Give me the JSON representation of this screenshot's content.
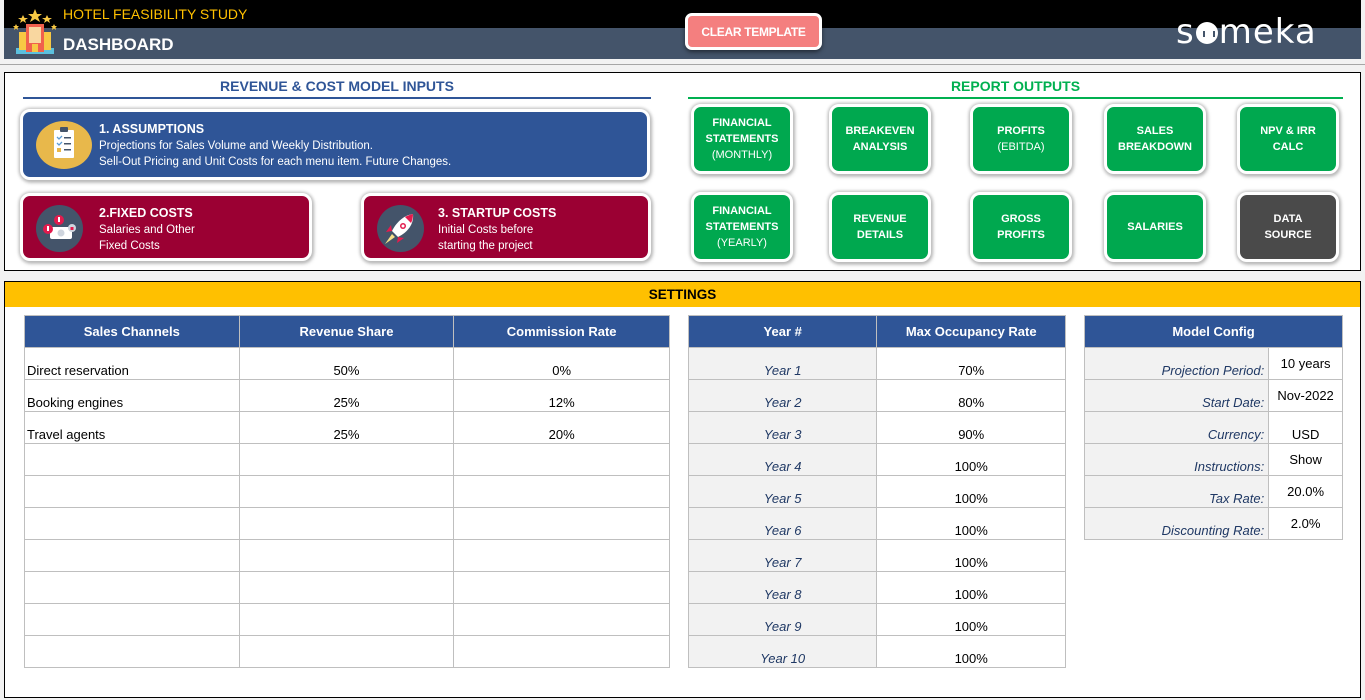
{
  "header": {
    "app_title": "HOTEL FEASIBILITY STUDY",
    "page_title": "DASHBOARD",
    "clear_button": "CLEAR TEMPLATE",
    "brand": {
      "before": "s",
      "after": "meka"
    },
    "colors": {
      "top_bar": "#000000",
      "bottom_bar": "#44546a",
      "app_title": "#ffc000",
      "clear_button": "#f47f7f"
    }
  },
  "inputs": {
    "title": "REVENUE & COST MODEL INPUTS",
    "color": "#2f5597",
    "buttons": [
      {
        "title": "1. ASSUMPTIONS",
        "line1": "Projections for Sales Volume and Weekly Distribution.",
        "line2": "Sell-Out Pricing and Unit Costs for each menu item. Future Changes.",
        "icon": "clipboard-checklist-icon",
        "color": "#2f5597"
      },
      {
        "title": "2.FIXED COSTS",
        "line1": "Salaries and Other",
        "line2": "Fixed Costs",
        "icon": "money-icon",
        "color": "#9b0033"
      },
      {
        "title": "3. STARTUP COSTS",
        "line1": "Initial Costs before",
        "line2": "starting the project",
        "icon": "rocket-icon",
        "color": "#9b0033"
      }
    ]
  },
  "outputs": {
    "title": "REPORT OUTPUTS",
    "color": "#00b050",
    "buttons": [
      {
        "l1": "FINANCIAL",
        "l2": "STATEMENTS",
        "sub": "(MONTHLY)"
      },
      {
        "l1": "BREAKEVEN",
        "l2": "ANALYSIS",
        "sub": ""
      },
      {
        "l1": "PROFITS",
        "l2": "",
        "sub": "(EBITDA)"
      },
      {
        "l1": "SALES",
        "l2": "BREAKDOWN",
        "sub": ""
      },
      {
        "l1": "NPV & IRR",
        "l2": "CALC",
        "sub": ""
      },
      {
        "l1": "FINANCIAL",
        "l2": "STATEMENTS",
        "sub": "(YEARLY)"
      },
      {
        "l1": "REVENUE",
        "l2": "DETAILS",
        "sub": ""
      },
      {
        "l1": "GROSS",
        "l2": "PROFITS",
        "sub": ""
      },
      {
        "l1": "SALARIES",
        "l2": "",
        "sub": ""
      },
      {
        "l1": "DATA",
        "l2": "SOURCE",
        "sub": ""
      }
    ]
  },
  "settings": {
    "title": "SETTINGS",
    "channels": {
      "headers": [
        "Sales Channels",
        "Revenue Share",
        "Commission Rate"
      ],
      "rows": [
        [
          "Direct reservation",
          "50%",
          "0%"
        ],
        [
          "Booking engines",
          "25%",
          "12%"
        ],
        [
          "Travel agents",
          "25%",
          "20%"
        ],
        [
          "",
          "",
          ""
        ],
        [
          "",
          "",
          ""
        ],
        [
          "",
          "",
          ""
        ],
        [
          "",
          "",
          ""
        ],
        [
          "",
          "",
          ""
        ],
        [
          "",
          "",
          ""
        ],
        [
          "",
          "",
          ""
        ]
      ]
    },
    "occupancy": {
      "headers": [
        "Year #",
        "Max Occupancy Rate"
      ],
      "rows": [
        [
          "Year 1",
          "70%"
        ],
        [
          "Year 2",
          "80%"
        ],
        [
          "Year 3",
          "90%"
        ],
        [
          "Year 4",
          "100%"
        ],
        [
          "Year 5",
          "100%"
        ],
        [
          "Year 6",
          "100%"
        ],
        [
          "Year 7",
          "100%"
        ],
        [
          "Year 8",
          "100%"
        ],
        [
          "Year 9",
          "100%"
        ],
        [
          "Year 10",
          "100%"
        ]
      ]
    },
    "config": {
      "header": "Model Config",
      "rows": [
        [
          "Projection Period:",
          "10 years"
        ],
        [
          "Start Date:",
          "Nov-2022"
        ],
        [
          "Currency:",
          "USD"
        ],
        [
          "Instructions:",
          "Show"
        ],
        [
          "Tax Rate:",
          "20.0%"
        ],
        [
          "Discounting Rate:",
          "2.0%"
        ]
      ]
    }
  }
}
